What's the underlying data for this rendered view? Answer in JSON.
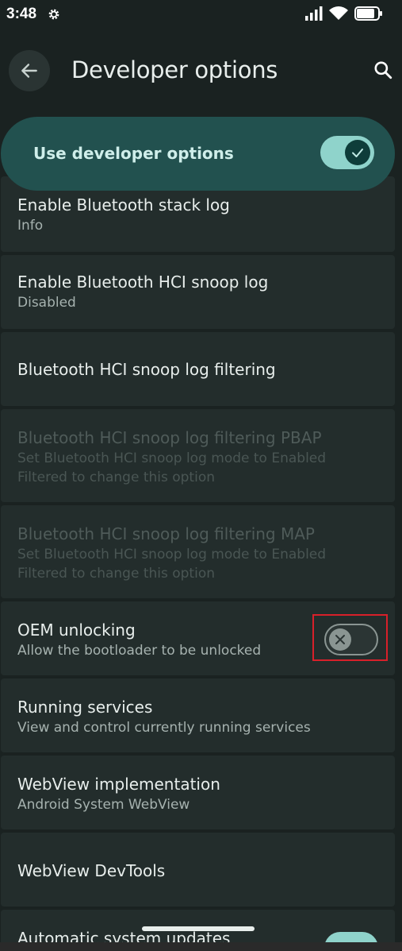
{
  "status_bar": {
    "time": "3:48"
  },
  "app_bar": {
    "title": "Developer options"
  },
  "master": {
    "label": "Use developer options",
    "enabled": true
  },
  "items": [
    {
      "title": "Enable Bluetooth stack log",
      "subtitle": "Info"
    },
    {
      "title": "Enable Bluetooth HCI snoop log",
      "subtitle": "Disabled"
    },
    {
      "title": "Bluetooth HCI snoop log filtering",
      "subtitle": ""
    },
    {
      "title": "Bluetooth HCI snoop log filtering PBAP",
      "subtitle_1": "Set Bluetooth HCI snoop log mode to Enabled",
      "subtitle_2": "Filtered to change this option",
      "disabled": true
    },
    {
      "title": "Bluetooth HCI snoop log filtering MAP",
      "subtitle_1": "Set Bluetooth HCI snoop log mode to Enabled",
      "subtitle_2": "Filtered to change this option",
      "disabled": true
    },
    {
      "title": "OEM unlocking",
      "subtitle": "Allow the bootloader to be unlocked",
      "toggle": false
    },
    {
      "title": "Running services",
      "subtitle": "View and control currently running services"
    },
    {
      "title": "WebView implementation",
      "subtitle": "Android System WebView"
    },
    {
      "title": "WebView DevTools",
      "subtitle": ""
    },
    {
      "title": "Automatic system updates",
      "toggle": true
    }
  ],
  "colors": {
    "accent": "#8fd3cb",
    "highlight": "#d8202a"
  }
}
